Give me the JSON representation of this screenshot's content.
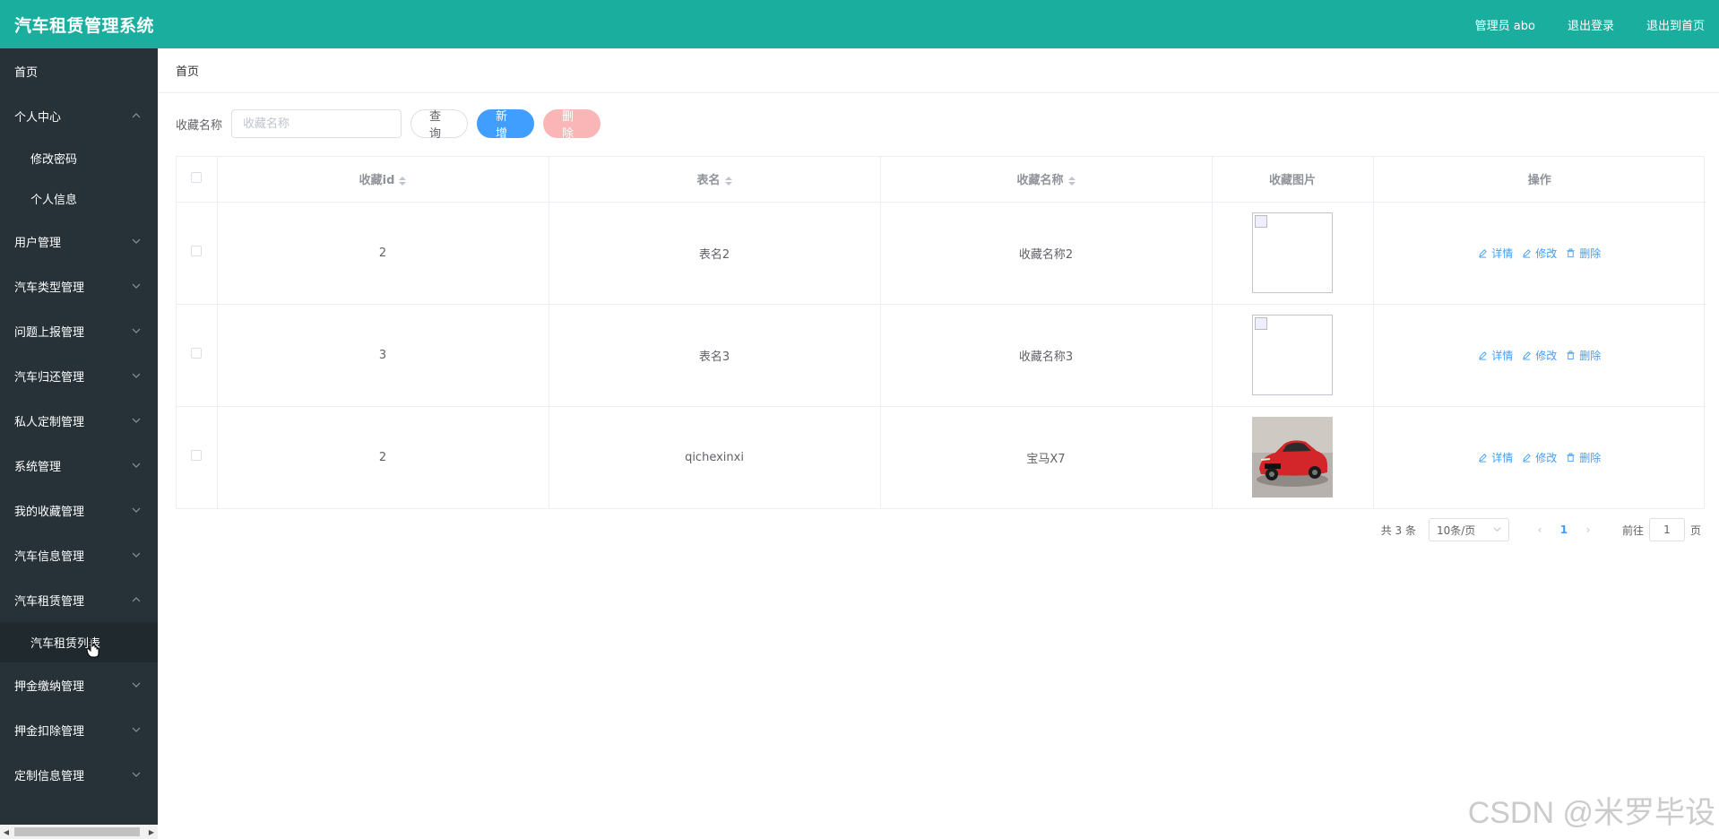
{
  "header": {
    "title": "汽车租赁管理系统",
    "links": [
      "管理员 abo",
      "退出登录",
      "退出到首页"
    ]
  },
  "sidebar": {
    "items": [
      {
        "label": "首页"
      },
      {
        "label": "个人中心",
        "expanded": true,
        "children": [
          "修改密码",
          "个人信息"
        ]
      },
      {
        "label": "用户管理"
      },
      {
        "label": "汽车类型管理"
      },
      {
        "label": "问题上报管理"
      },
      {
        "label": "汽车归还管理"
      },
      {
        "label": "私人定制管理"
      },
      {
        "label": "系统管理"
      },
      {
        "label": "我的收藏管理"
      },
      {
        "label": "汽车信息管理"
      },
      {
        "label": "汽车租赁管理",
        "expanded": true,
        "children": [
          "汽车租赁列表"
        ]
      },
      {
        "label": "押金缴纳管理"
      },
      {
        "label": "押金扣除管理"
      },
      {
        "label": "定制信息管理"
      }
    ]
  },
  "breadcrumb": "首页",
  "search": {
    "label": "收藏名称",
    "placeholder": "收藏名称",
    "value": ""
  },
  "buttons": {
    "query": "查询",
    "add": "新增",
    "delete": "删除"
  },
  "table": {
    "columns": [
      "收藏id",
      "表名",
      "收藏名称",
      "收藏图片",
      "操作"
    ],
    "rows": [
      {
        "id": "2",
        "table": "表名2",
        "name": "收藏名称2",
        "image": "broken"
      },
      {
        "id": "3",
        "table": "表名3",
        "name": "收藏名称3",
        "image": "broken"
      },
      {
        "id": "2",
        "table": "qichexinxi",
        "name": "宝马X7",
        "image": "red-car"
      }
    ],
    "actions": [
      "详情",
      "修改",
      "删除"
    ]
  },
  "pagination": {
    "total": "共 3 条",
    "page_size": "10条/页",
    "current_page": "1",
    "goto_prefix": "前往",
    "goto_value": "1",
    "goto_suffix": "页"
  },
  "watermark": "CSDN @米罗毕设",
  "colors": {
    "header": "#1aae9f",
    "sidebar": "#263238",
    "primary": "#409eff",
    "danger_disabled": "#fab6b6"
  }
}
